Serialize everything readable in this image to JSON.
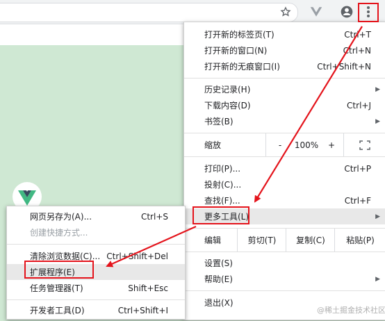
{
  "toolbar": {
    "icons": [
      "star-icon",
      "vue-devtools-icon",
      "account-icon",
      "more-vert-icon"
    ]
  },
  "main_menu": {
    "items": [
      {
        "label": "打开新的标签页(T)",
        "shortcut": "Ctrl+T"
      },
      {
        "label": "打开新的窗口(N)",
        "shortcut": "Ctrl+N"
      },
      {
        "label": "打开新的无痕窗口(I)",
        "shortcut": "Ctrl+Shift+N"
      },
      {
        "label": "历史记录(H)",
        "shortcut": "▶"
      },
      {
        "label": "下载内容(D)",
        "shortcut": "Ctrl+J"
      },
      {
        "label": "书签(B)",
        "shortcut": "▶"
      }
    ],
    "zoom": {
      "label": "缩放",
      "minus": "-",
      "value": "100%",
      "plus": "+"
    },
    "items2": [
      {
        "label": "打印(P)...",
        "shortcut": "Ctrl+P"
      },
      {
        "label": "投射(C)...",
        "shortcut": ""
      },
      {
        "label": "查找(F)...",
        "shortcut": "Ctrl+F"
      },
      {
        "label": "更多工具(L)",
        "shortcut": "▶"
      }
    ],
    "edit": {
      "label": "编辑",
      "cut": "剪切(T)",
      "copy": "复制(C)",
      "paste": "粘贴(P)"
    },
    "items3": [
      {
        "label": "设置(S)",
        "shortcut": ""
      },
      {
        "label": "帮助(E)",
        "shortcut": "▶"
      },
      {
        "label": "退出(X)",
        "shortcut": ""
      }
    ]
  },
  "sub_menu": {
    "items": [
      {
        "label": "网页另存为(A)...",
        "shortcut": "Ctrl+S"
      },
      {
        "label": "创建快捷方式...",
        "shortcut": ""
      },
      {
        "label": "清除浏览数据(C)...",
        "shortcut": "Ctrl+Shift+Del"
      },
      {
        "label": "扩展程序(E)",
        "shortcut": ""
      },
      {
        "label": "任务管理器(T)",
        "shortcut": "Shift+Esc"
      },
      {
        "label": "开发者工具(D)",
        "shortcut": "Ctrl+Shift+I"
      }
    ]
  },
  "watermark": "@稀土掘金技术社区",
  "colors": {
    "annotation_red": "#e4131b",
    "page_green": "#cfe8d3",
    "vue_green": "#41b883",
    "vue_dark": "#35495e"
  }
}
